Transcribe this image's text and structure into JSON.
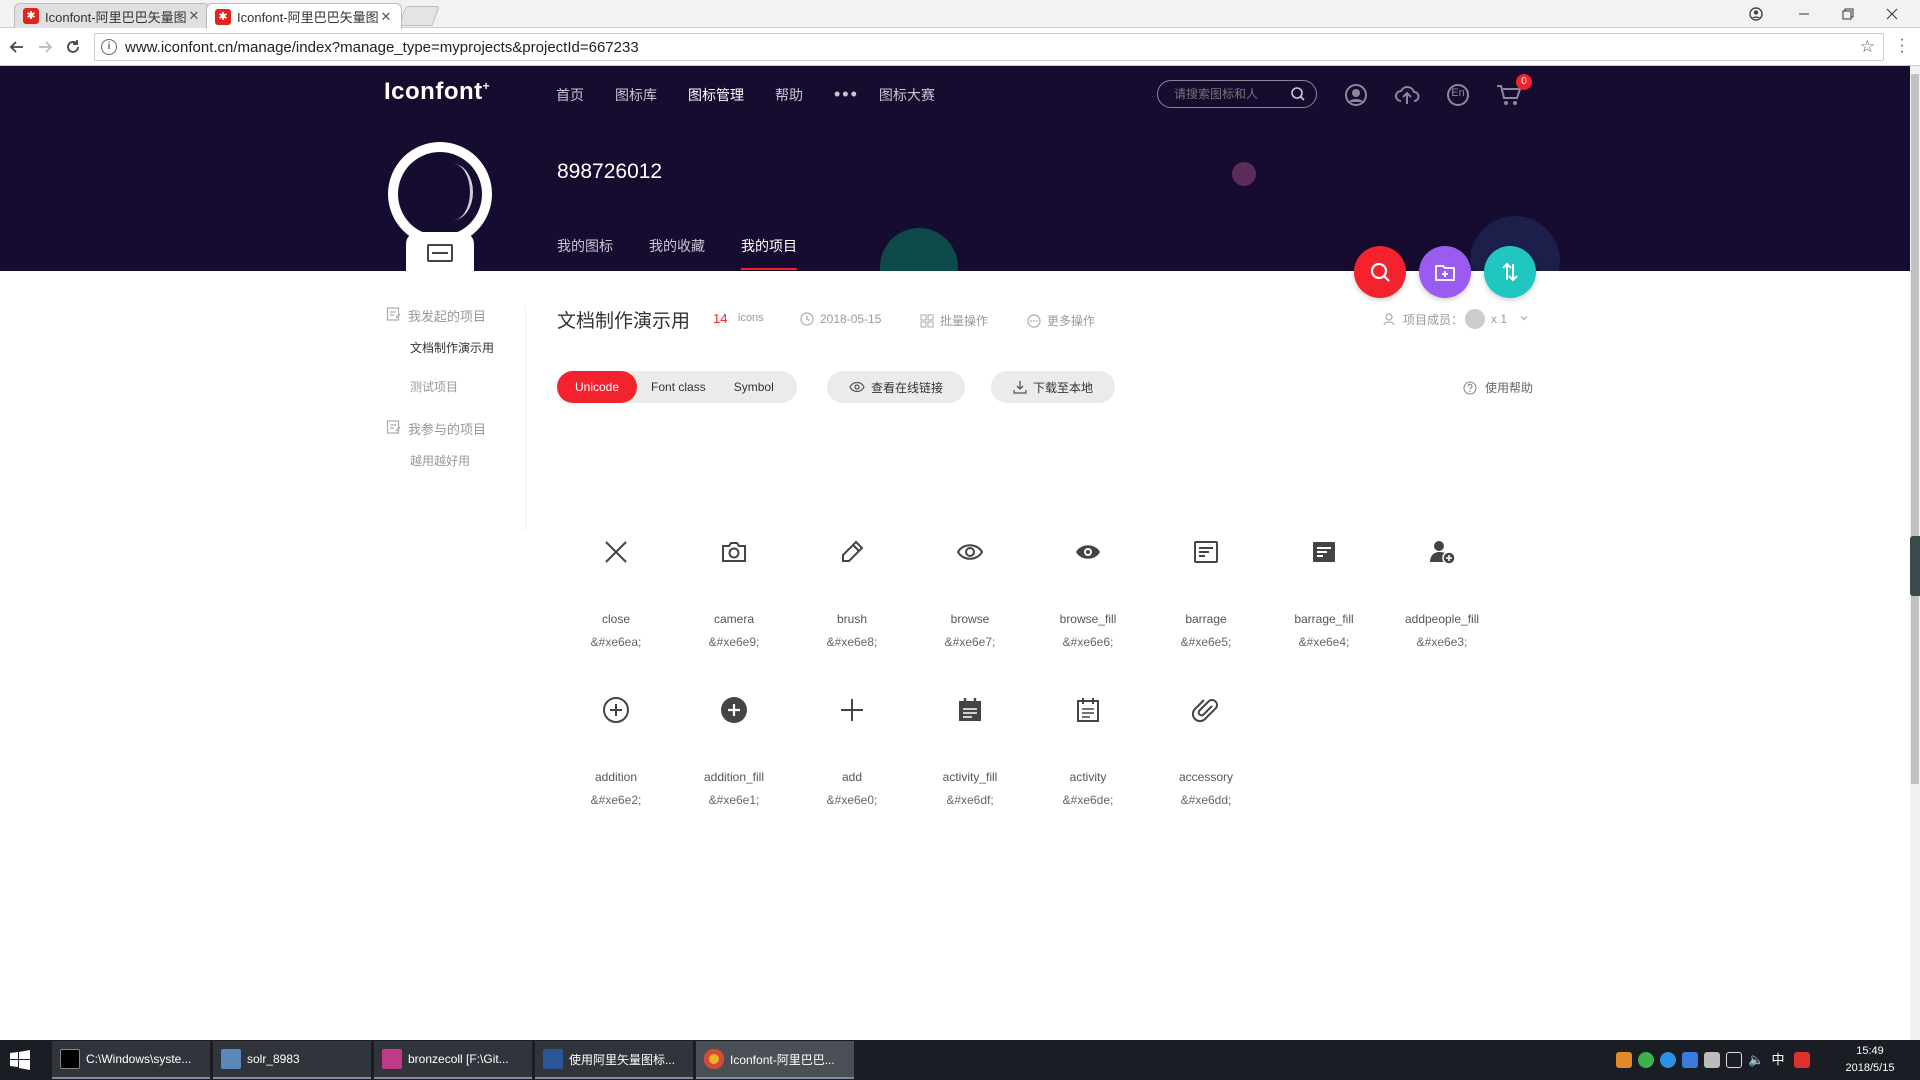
{
  "browser": {
    "tabs": [
      {
        "title": "Iconfont-阿里巴巴矢量图标库",
        "close": "✕"
      },
      {
        "title": "Iconfont-阿里巴巴矢量图标库",
        "close": "✕"
      }
    ],
    "url": "www.iconfont.cn/manage/index?manage_type=myprojects&projectId=667233"
  },
  "header": {
    "logo": "Iconfont",
    "logo_mark": "+",
    "nav": [
      "首页",
      "图标库",
      "图标管理",
      "帮助"
    ],
    "nav_more": "•••",
    "nav_contest": "图标大赛",
    "search_placeholder": "请搜索图标和人",
    "lang": "En",
    "cart_count": "0"
  },
  "profile": {
    "username": "898726012",
    "tabs": [
      "我的图标",
      "我的收藏",
      "我的项目"
    ]
  },
  "sidebar": {
    "group1": "我发起的项目",
    "group1_items": [
      "文档制作演示用",
      "测试项目"
    ],
    "group2": "我参与的项目",
    "group2_items": [
      "越用越好用"
    ]
  },
  "project": {
    "title": "文档制作演示用",
    "count": "14",
    "count_unit": "icons",
    "date": "2018-05-15",
    "batch": "批量操作",
    "more": "更多操作",
    "members_label": "项目成员：",
    "members_count": "x 1"
  },
  "toolbar": {
    "modes": [
      "Unicode",
      "Font class",
      "Symbol"
    ],
    "view_link": "查看在线链接",
    "download": "下载至本地",
    "help": "使用帮助"
  },
  "icons": [
    {
      "name": "close",
      "code": "&#xe6ea;",
      "icon": "close-icon"
    },
    {
      "name": "camera",
      "code": "&#xe6e9;",
      "icon": "camera-icon"
    },
    {
      "name": "brush",
      "code": "&#xe6e8;",
      "icon": "brush-icon"
    },
    {
      "name": "browse",
      "code": "&#xe6e7;",
      "icon": "eye-icon"
    },
    {
      "name": "browse_fill",
      "code": "&#xe6e6;",
      "icon": "eye-fill-icon"
    },
    {
      "name": "barrage",
      "code": "&#xe6e5;",
      "icon": "barrage-icon"
    },
    {
      "name": "barrage_fill",
      "code": "&#xe6e4;",
      "icon": "barrage-fill-icon"
    },
    {
      "name": "addpeople_fill",
      "code": "&#xe6e3;",
      "icon": "add-people-fill-icon"
    },
    {
      "name": "addition",
      "code": "&#xe6e2;",
      "icon": "plus-circle-icon"
    },
    {
      "name": "addition_fill",
      "code": "&#xe6e1;",
      "icon": "plus-circle-fill-icon"
    },
    {
      "name": "add",
      "code": "&#xe6e0;",
      "icon": "plus-icon"
    },
    {
      "name": "activity_fill",
      "code": "&#xe6df;",
      "icon": "calendar-fill-icon"
    },
    {
      "name": "activity",
      "code": "&#xe6de;",
      "icon": "calendar-icon"
    },
    {
      "name": "accessory",
      "code": "&#xe6dd;",
      "icon": "paperclip-icon"
    }
  ],
  "taskbar": {
    "items": [
      "C:\\Windows\\syste...",
      "solr_8983",
      "bronzecoll [F:\\Git...",
      "使用阿里矢量图标...",
      "Iconfont-阿里巴巴..."
    ],
    "ime": "中",
    "time": "15:49",
    "date": "2018/5/15"
  },
  "colors": {
    "banner": "#150c30",
    "accent_red": "#f3222d",
    "fab_purple": "#9a5cf0",
    "fab_teal": "#1fc7c0"
  }
}
